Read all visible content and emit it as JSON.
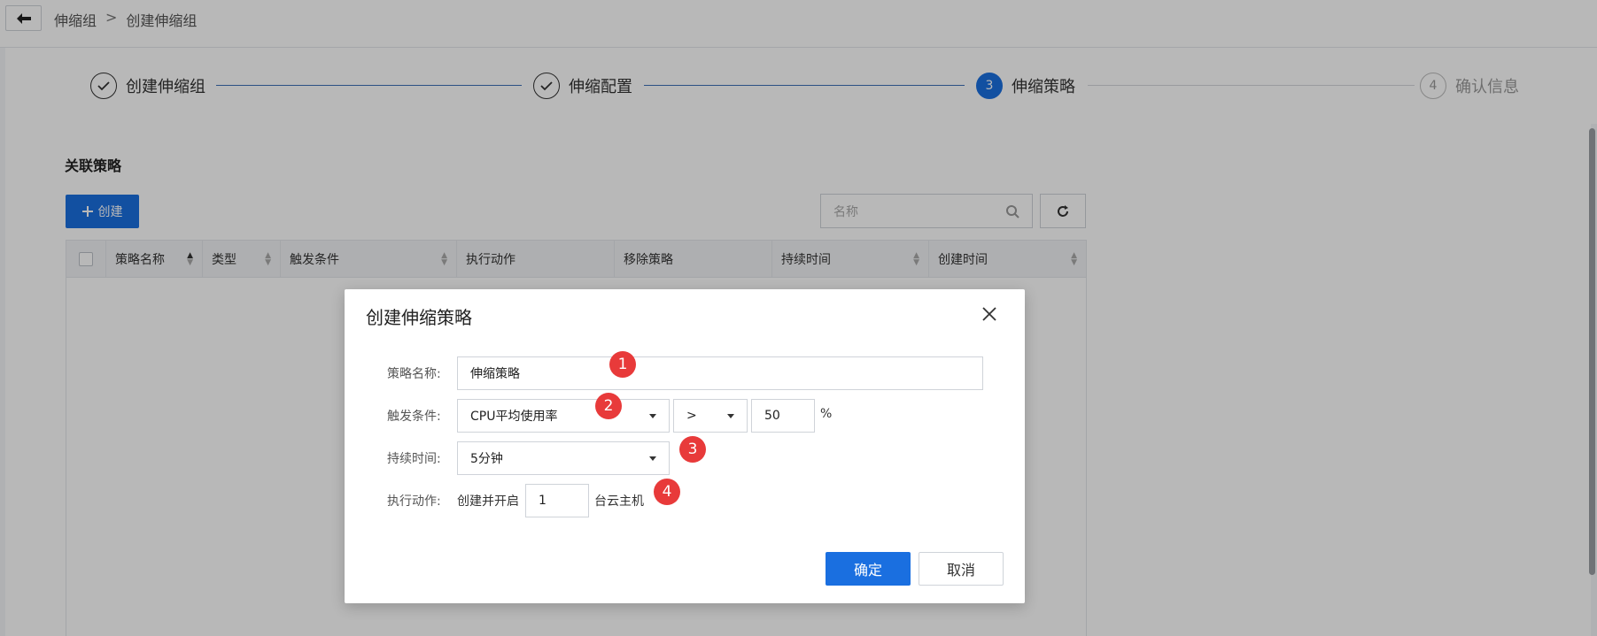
{
  "breadcrumb": {
    "parent": "伸缩组",
    "separator": ">",
    "current": "创建伸缩组"
  },
  "steps": [
    {
      "num": "",
      "label": "创建伸缩组",
      "state": "done"
    },
    {
      "num": "",
      "label": "伸缩配置",
      "state": "done"
    },
    {
      "num": "3",
      "label": "伸缩策略",
      "state": "active"
    },
    {
      "num": "4",
      "label": "确认信息",
      "state": "todo"
    }
  ],
  "section": {
    "title": "关联策略",
    "create_label": "创建",
    "search_placeholder": "名称"
  },
  "table": {
    "columns": [
      "策略名称",
      "类型",
      "触发条件",
      "执行动作",
      "移除策略",
      "持续时间",
      "创建时间"
    ]
  },
  "modal": {
    "title": "创建伸缩策略",
    "name_label": "策略名称:",
    "name_value": "伸缩策略",
    "trigger_label": "触发条件:",
    "trigger_metric": "CPU平均使用率",
    "trigger_operator": ">",
    "trigger_value": "50",
    "trigger_unit": "%",
    "duration_label": "持续时间:",
    "duration_value": "5分钟",
    "action_label": "执行动作:",
    "action_prefix": "创建并开启",
    "action_count": "1",
    "action_suffix": "台云主机",
    "confirm_label": "确定",
    "cancel_label": "取消"
  },
  "annotations": [
    "1",
    "2",
    "3",
    "4"
  ],
  "colors": {
    "primary": "#1a6fe0",
    "badge": "#e83a3a"
  }
}
